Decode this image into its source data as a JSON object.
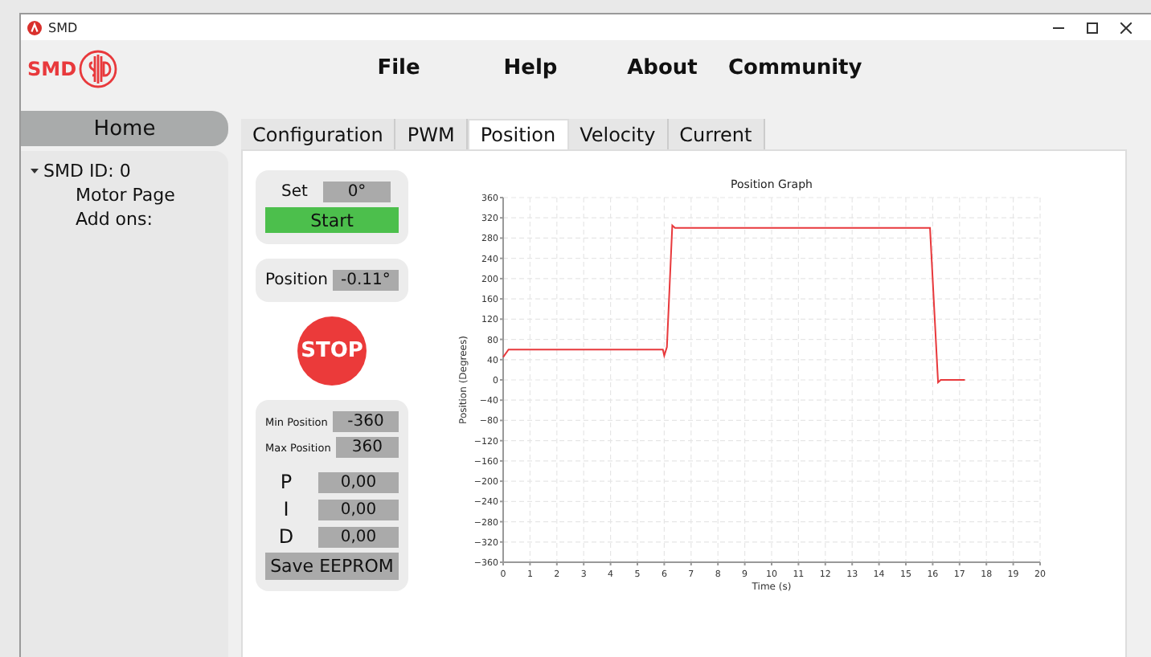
{
  "window": {
    "title": "SMD"
  },
  "logo": {
    "text": "SMD"
  },
  "menu": [
    "File",
    "Help",
    "About",
    "Community"
  ],
  "sidebar": {
    "home": "Home",
    "tree": [
      {
        "label": "SMD ID: 0",
        "expanded": true,
        "children": [
          {
            "label": "Motor Page"
          },
          {
            "label": "Add ons:"
          }
        ]
      }
    ]
  },
  "tabs": [
    {
      "label": "Configuration",
      "selected": false
    },
    {
      "label": "PWM",
      "selected": false
    },
    {
      "label": "Position",
      "selected": true
    },
    {
      "label": "Velocity",
      "selected": false
    },
    {
      "label": "Current",
      "selected": false
    }
  ],
  "setpoint": {
    "label": "Set",
    "value": "0°",
    "button": "Start"
  },
  "position": {
    "label": "Position",
    "value": "-0.11°"
  },
  "stop": "STOP",
  "limits": [
    {
      "label": "Min Position",
      "value": "-360"
    },
    {
      "label": "Max Position",
      "value": "360"
    }
  ],
  "gains": [
    {
      "label": "P",
      "value": "0,00"
    },
    {
      "label": "I",
      "value": "0,00"
    },
    {
      "label": "D",
      "value": "0,00"
    }
  ],
  "save": "Save EEPROM",
  "chart_data": {
    "type": "line",
    "title": "Position Graph",
    "xlabel": "Time (s)",
    "ylabel": "Position (Degrees)",
    "x": [
      0,
      0.2,
      5.95,
      6.0,
      6.1,
      6.3,
      6.4,
      15.9,
      16.2,
      16.3,
      17.2
    ],
    "grid": true,
    "series": [
      {
        "color": "#e8393c",
        "values": [
          45,
          60,
          60,
          48,
          65,
          305,
          300,
          300,
          -5,
          0,
          0
        ]
      }
    ],
    "xlim": [
      0,
      20
    ],
    "ylim": [
      -360,
      360
    ],
    "xticks": [
      0,
      1,
      2,
      3,
      4,
      5,
      6,
      7,
      8,
      9,
      10,
      11,
      12,
      13,
      14,
      15,
      16,
      17,
      18,
      19,
      20
    ],
    "yticks": [
      -360,
      -320,
      -280,
      -240,
      -200,
      -160,
      -120,
      -80,
      -40,
      0,
      40,
      80,
      120,
      160,
      200,
      240,
      280,
      320,
      360
    ]
  }
}
